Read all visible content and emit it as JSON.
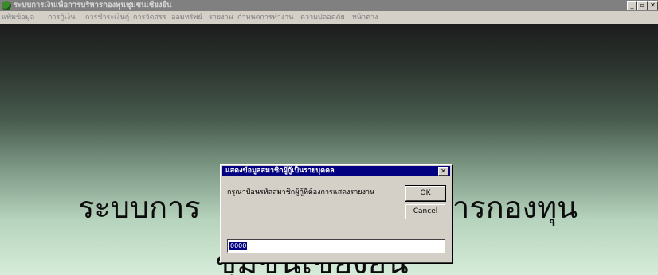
{
  "window": {
    "title": "ระบบการเงินเพื่อการบริหารกองทุนชุมชนเชียงยืน",
    "controls": {
      "minimize": "_",
      "maximize": "▫",
      "close": "✕"
    }
  },
  "menu": [
    "แฟ้มข้อมูล",
    "การกู้เงิน",
    "การชำระเงินกู้",
    "การจัดสรร",
    "ออมทรัพย์",
    "รายงาน",
    "กำหนดการทำงาน",
    "ความปลอดภัย",
    "หน้าต่าง"
  ],
  "background": {
    "line1_left": "ระบบการ",
    "line1_right": "ารกองทุน",
    "line2": "ชุมชนเชียงยืน"
  },
  "dialog": {
    "title": "แสดงข้อมูลสมาชิกผู้กู้เป็นรายบุคคล",
    "close": "✕",
    "prompt": "กรุณาป้อนรหัสสมาชิกผู้กู้ที่ต้องการแสดงรายงาน",
    "ok_label": "OK",
    "cancel_label": "Cancel",
    "input_value": "0000"
  }
}
